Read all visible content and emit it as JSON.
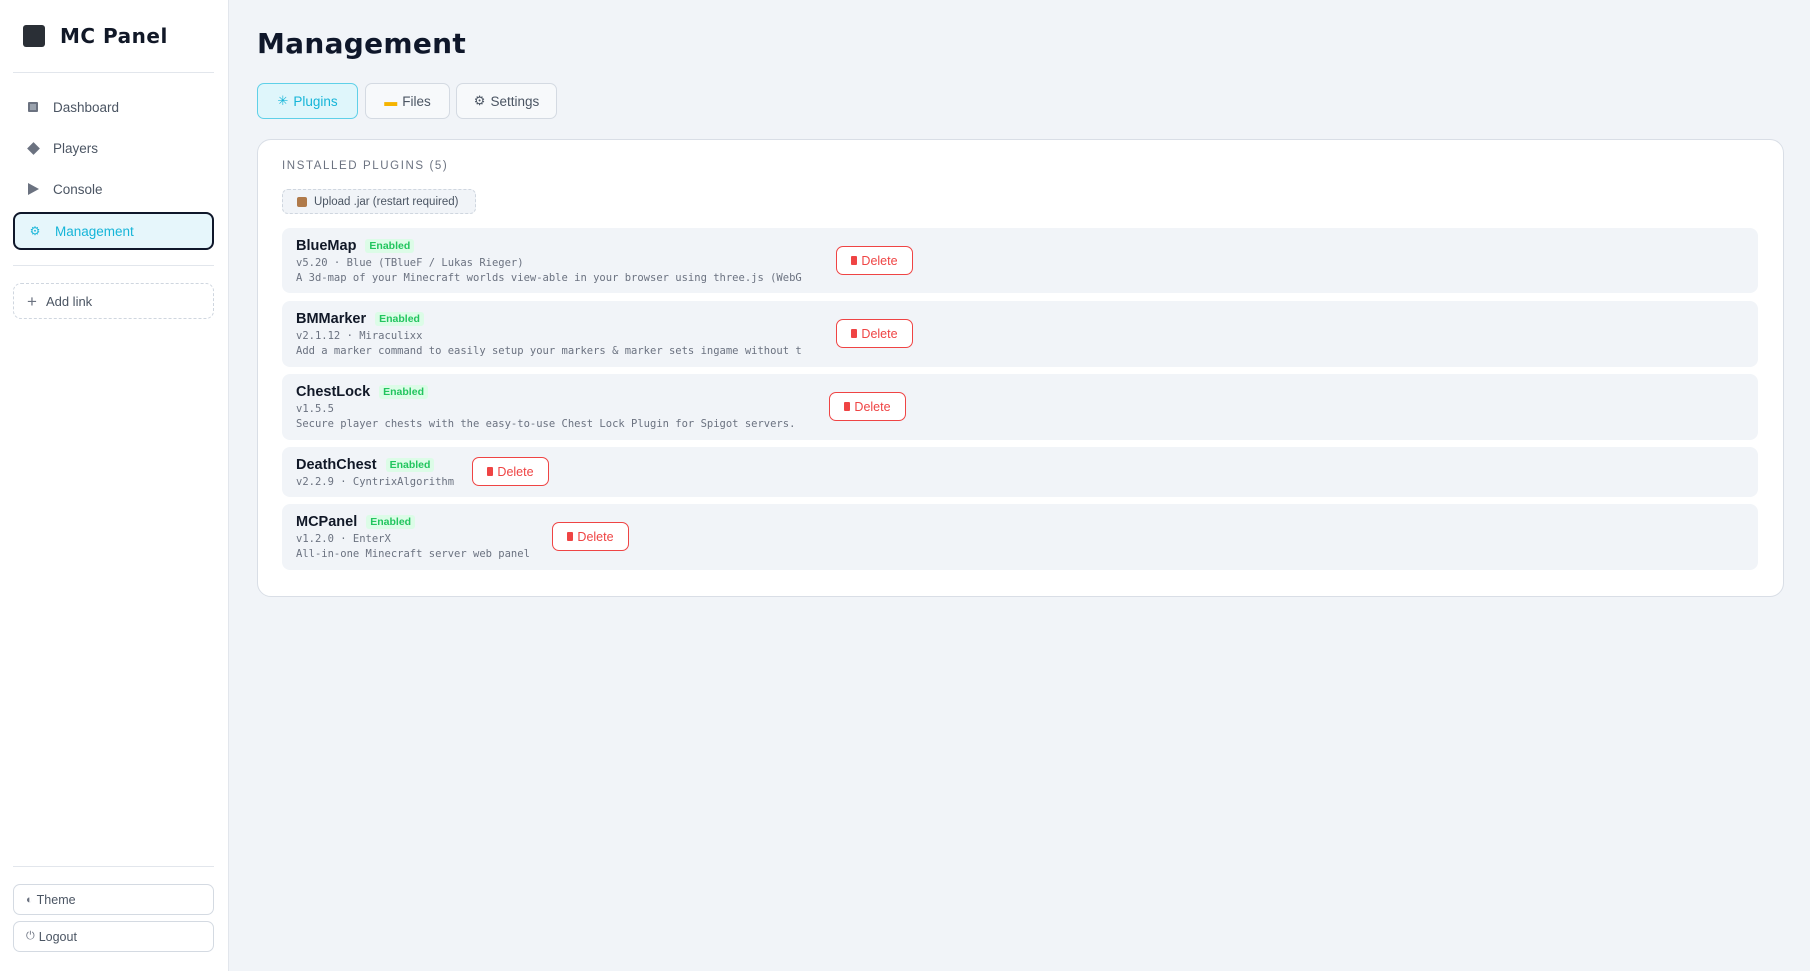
{
  "app": {
    "name": "MC Panel"
  },
  "sidebar": {
    "items": [
      {
        "label": "Dashboard",
        "icon": "dashboard-icon",
        "active": false
      },
      {
        "label": "Players",
        "icon": "players-icon",
        "active": false
      },
      {
        "label": "Console",
        "icon": "console-icon",
        "active": false
      },
      {
        "label": "Management",
        "icon": "gear-icon",
        "active": true
      }
    ],
    "add_link": "Add link",
    "theme": "Theme",
    "logout": "Logout"
  },
  "main": {
    "title": "Management",
    "tabs": [
      {
        "label": "Plugins",
        "icon": "puzzle-icon",
        "active": true
      },
      {
        "label": "Files",
        "icon": "folder-icon",
        "active": false
      },
      {
        "label": "Settings",
        "icon": "gear-icon",
        "active": false
      }
    ],
    "section_heading": "INSTALLED PLUGINS (5)",
    "upload_label": "Upload .jar (restart required)",
    "delete_label": "Delete",
    "plugins": [
      {
        "name": "BlueMap",
        "status": "Enabled",
        "meta": "v5.20 · Blue (TBlueF / Lukas Rieger)",
        "description": "A 3d-map of your Minecraft worlds view-able in your browser using three.js (WebG"
      },
      {
        "name": "BMMarker",
        "status": "Enabled",
        "meta": "v2.1.12 · Miraculixx",
        "description": "Add a marker command to easily setup your markers & marker sets ingame without t"
      },
      {
        "name": "ChestLock",
        "status": "Enabled",
        "meta": "v1.5.5",
        "description": "Secure player chests with the easy-to-use Chest Lock Plugin for Spigot servers."
      },
      {
        "name": "DeathChest",
        "status": "Enabled",
        "meta": "v2.2.9 · CyntrixAlgorithm",
        "description": ""
      },
      {
        "name": "MCPanel",
        "status": "Enabled",
        "meta": "v1.2.0 · EnterX",
        "description": "All-in-one Minecraft server web panel"
      }
    ]
  },
  "colors": {
    "accent": "#16b5d8",
    "danger": "#ef4444",
    "success": "#22c55e"
  }
}
